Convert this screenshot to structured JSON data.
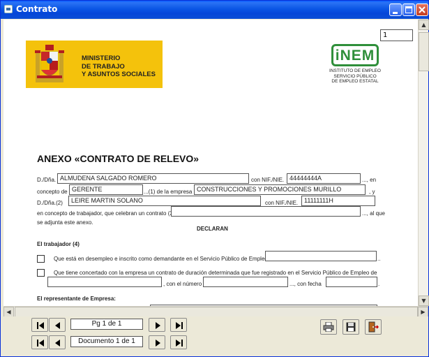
{
  "window": {
    "title": "Contrato"
  },
  "page_number_box": "1",
  "ministry": {
    "line1": "MINISTERIO",
    "line2": "DE TRABAJO",
    "line3": "Y ASUNTOS SOCIALES"
  },
  "inem": {
    "logo": "iNEM",
    "line1": "INSTITUTO DE EMPLEO",
    "line2": "SERVICIO PÚBLICO",
    "line3": "DE EMPLEO ESTATAL"
  },
  "document": {
    "title": "ANEXO «CONTRATO DE RELEVO»",
    "row1": {
      "label": "D./Dña.",
      "name": "ALMUDENA SALGADO ROMERO",
      "nif_label": "con NIF./NIE.",
      "nif": "44444444A",
      "suffix": "..., en"
    },
    "row2": {
      "label": "concepto de",
      "concept": "GERENTE",
      "mid": "...(1) de la empresa",
      "company": "CONSTRUCCIONES Y PROMOCIONES MURILLO",
      "suffix": ", y"
    },
    "row3": {
      "label": "D./Dña.(2)",
      "name": "LEIRE MARTIN SOLANO",
      "nif_label": "con NIF./NIE.",
      "nif": "11111111H"
    },
    "row4": {
      "text": "en concepto de trabajador, que celebran un contrato (3)....",
      "suffix": "..., al que"
    },
    "row5": "se adjunta este anexo.",
    "declaran": "DECLARAN",
    "trabajador_heading": "El trabajador (4)",
    "option1": "Que está en desempleo e inscrito como demandante en el Servicio Público de Empleo de",
    "option2": "Que tiene concertado con la empresa un contrato de duración determinada que fue registrado en el Servicio Público de Empleo de",
    "con_numero": ", con el número",
    "con_fecha": "..., con fecha",
    "representante_heading": "El representante de Empresa:"
  },
  "nav": {
    "page_label": "Pg 1 de 1",
    "document_label": "Documento 1 de 1"
  },
  "icons": {
    "print": "printer-icon",
    "save": "floppy-disk-icon",
    "exit": "exit-door-icon"
  },
  "colors": {
    "ministry_yellow": "#f4c20c",
    "inem_green": "#2f8f3a",
    "titlebar_blue": "#0b56e5"
  }
}
